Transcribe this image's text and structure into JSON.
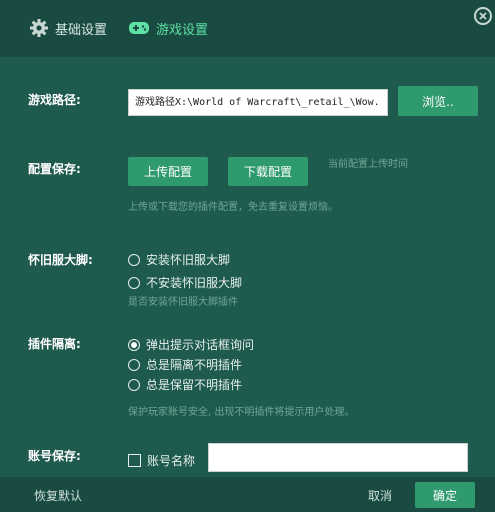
{
  "tabs": {
    "basic_label": "基础设置",
    "game_label": "游戏设置"
  },
  "game_path": {
    "label": "游戏路径:",
    "value": "游戏路径X:\\World of Warcraft\\_retail_\\Wow.",
    "browse_label": "浏览.."
  },
  "config_save": {
    "label": "配置保存:",
    "upload_label": "上传配置",
    "download_label": "下载配置",
    "last_upload_hint": "当前配置上传时间",
    "description": "上传或下载您的插件配置，免去重复设置烦恼。"
  },
  "classic": {
    "label": "怀旧服大脚:",
    "options": [
      "安装怀旧服大脚",
      "不安装怀旧服大脚"
    ],
    "description": "是否安装怀旧服大脚插件"
  },
  "addon_isolation": {
    "label": "插件隔离:",
    "options": [
      "弹出提示对话框询问",
      "总是隔离不明插件",
      "总是保留不明插件"
    ],
    "selected_index": 0,
    "description": "保护玩家账号安全, 出现不明插件将提示用户处理。"
  },
  "account_save": {
    "label": "账号保存:",
    "checkbox_label": "账号名称",
    "value": ""
  },
  "footer": {
    "reset_label": "恢复默认",
    "cancel_label": "取消",
    "ok_label": "确定"
  },
  "colors": {
    "background": "#1e5a4e",
    "header": "#1a4b42",
    "accent": "#2f9a6e",
    "active_tab": "#5ee0a6"
  },
  "icons": {
    "basic_tab": "gear-icon",
    "game_tab": "gamepad-icon",
    "close": "close-icon"
  }
}
